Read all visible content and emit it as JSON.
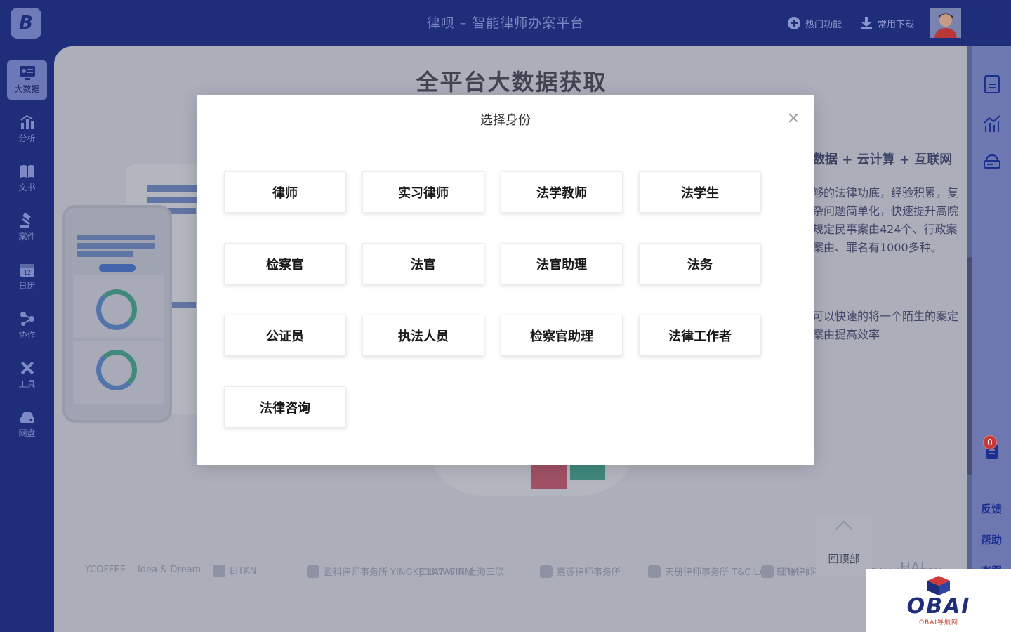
{
  "header": {
    "logo_text": "B",
    "title": "律呗 – 智能律师办案平台",
    "hot_features": "热门功能",
    "downloads": "常用下载"
  },
  "sidebar": {
    "items": [
      {
        "label": "大数据",
        "icon": "big-data-icon",
        "active": true
      },
      {
        "label": "分析",
        "icon": "analysis-icon"
      },
      {
        "label": "文书",
        "icon": "document-icon"
      },
      {
        "label": "案件",
        "icon": "gavel-icon"
      },
      {
        "label": "日历",
        "icon": "calendar-icon",
        "icon_text": "12"
      },
      {
        "label": "协作",
        "icon": "collaboration-icon"
      },
      {
        "label": "工具",
        "icon": "tools-icon"
      },
      {
        "label": "网盘",
        "icon": "cloud-drive-icon"
      }
    ]
  },
  "main": {
    "title": "全平台大数据获取",
    "feature_heading": "数据 + 云计算 + 互联网",
    "feature_paragraph_1": "够的法律功底，经验积累，复杂问题简单化，快速提升高院规定民事案由424个、行政案案由、罪名有1000多种。",
    "feature_paragraph_2": "可以快速的将一个陌生的案定案由提高效率",
    "brands": [
      "YCOFFEE —Idea & Dream—",
      "EITKN",
      "盈科律师事务所 YINGKE LAW FIRM",
      "JOINT-WIN 上海三联",
      "嘉源律师事务所",
      "天册律师事务所 T&C LAW FIRM",
      "國浩律師事務所 GRANDALL LAW FIRM",
      "HAI"
    ],
    "back_to_top": "回顶部"
  },
  "right_rail": {
    "feedback": "反馈",
    "help": "帮助",
    "customer_service": "客服",
    "badge_count": "0"
  },
  "modal": {
    "title": "选择身份",
    "roles": [
      "律师",
      "实习律师",
      "法学教师",
      "法学生",
      "检察官",
      "法官",
      "法官助理",
      "法务",
      "公证员",
      "执法人员",
      "检察官助理",
      "法律工作者",
      "法律咨询"
    ]
  },
  "watermark": {
    "text": "OBAI",
    "sub": "OBAI导航网"
  }
}
